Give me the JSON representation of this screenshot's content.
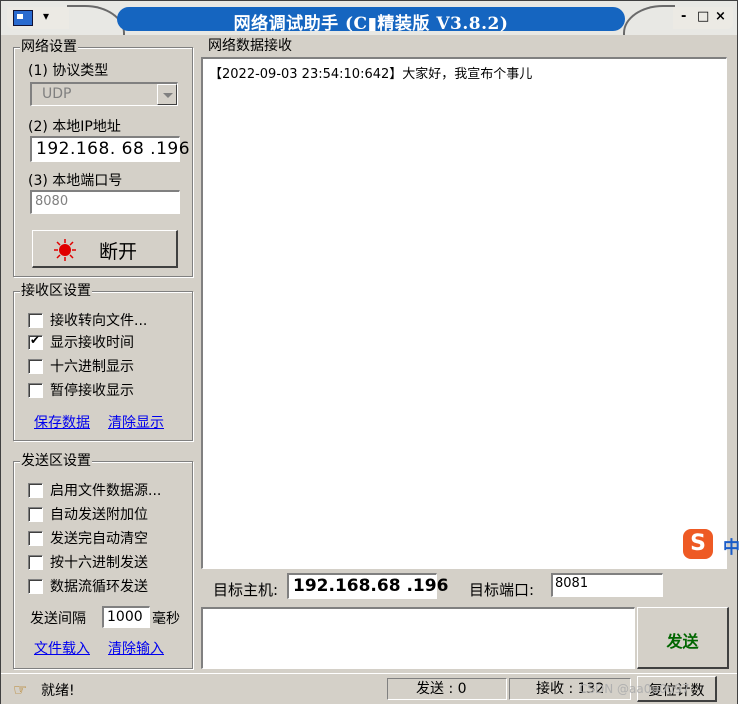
{
  "window": {
    "title": "网络调试助手 (C▮精装版 V3.8.2)",
    "controls": {
      "minimize": "-",
      "maximize": "□",
      "close": "×"
    }
  },
  "network_settings": {
    "group_title": "网络设置",
    "protocol_label": "(1) 协议类型",
    "protocol_value": "UDP",
    "local_ip_label": "(2) 本地IP地址",
    "local_ip": [
      "192",
      "168",
      "68",
      "196"
    ],
    "local_port_label": "(3) 本地端口号",
    "local_port_value": "8080",
    "connect_button": "断开",
    "connect_indicator_color": "#e00000"
  },
  "receive_settings": {
    "group_title": "接收区设置",
    "options": [
      {
        "label": "接收转向文件...",
        "checked": false
      },
      {
        "label": "显示接收时间",
        "checked": true
      },
      {
        "label": "十六进制显示",
        "checked": false
      },
      {
        "label": "暂停接收显示",
        "checked": false
      }
    ],
    "save_link": "保存数据",
    "clear_link": "清除显示"
  },
  "send_settings": {
    "group_title": "发送区设置",
    "options": [
      {
        "label": "启用文件数据源...",
        "checked": false
      },
      {
        "label": "自动发送附加位",
        "checked": false
      },
      {
        "label": "发送完自动清空",
        "checked": false
      },
      {
        "label": "按十六进制发送",
        "checked": false
      },
      {
        "label": "数据流循环发送",
        "checked": false
      }
    ],
    "interval_label": "发送间隔",
    "interval_value": "1000",
    "interval_unit": "毫秒",
    "load_file_link": "文件载入",
    "clear_input_link": "清除输入"
  },
  "receive_area": {
    "group_title": "网络数据接收",
    "lines": [
      "【2022-09-03 23:54:10:642】大家好，我宣布个事儿"
    ]
  },
  "target": {
    "host_label": "目标主机:",
    "host_value": "192.168.68 .196",
    "port_label": "目标端口:",
    "port_value": "8081"
  },
  "send_area": {
    "input_value": "",
    "send_button": "发送"
  },
  "ime": {
    "glyph": "S",
    "mode": "中",
    "color": "#ee5a24"
  },
  "status": {
    "ready_text": "就绪!",
    "sent_label": "发送 : 0",
    "received_label": "接收 : 132",
    "reset_button": "复位计数"
  },
  "watermark": "CSDN @aa0u0u97"
}
